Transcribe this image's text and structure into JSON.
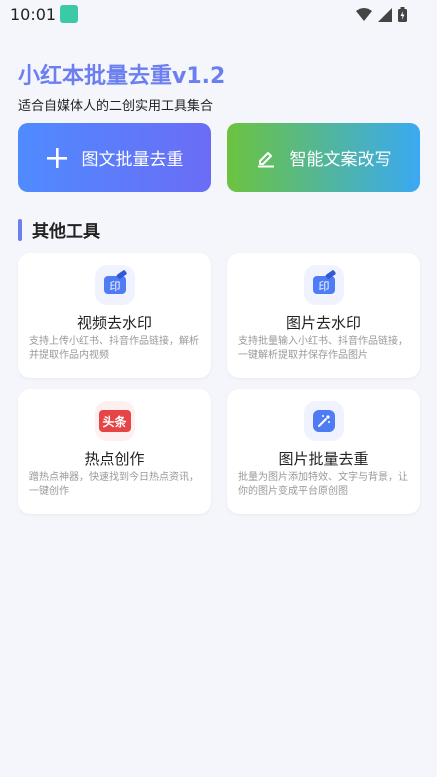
{
  "status": {
    "time": "10:01"
  },
  "header": {
    "title": "小红本批量去重v1.2",
    "subtitle": "适合自媒体人的二创实用工具集合"
  },
  "actions": {
    "left_label": "图文批量去重",
    "right_label": "智能文案改写"
  },
  "section": {
    "title": "其他工具"
  },
  "tools": [
    {
      "name": "视频去水印",
      "desc": "支持上传小红书、抖音作品链接，解析并提取作品内视频",
      "icon": "watermark-video-icon"
    },
    {
      "name": "图片去水印",
      "desc": "支持批量输入小红书、抖音作品链接，一键解析提取并保存作品图片",
      "icon": "watermark-image-icon"
    },
    {
      "name": "热点创作",
      "desc": "蹭热点神器，快速找到今日热点资讯，一键创作",
      "icon": "hot-topic-icon",
      "badge": "头条"
    },
    {
      "name": "图片批量去重",
      "desc": "批量为图片添加特效、文字与背景，让你的图片变成平台原创图",
      "icon": "magic-image-icon"
    }
  ],
  "colors": {
    "accent": "#6b7ff0",
    "btn_left_start": "#4f8bff",
    "btn_left_end": "#6b6cf5",
    "btn_right_start": "#6cc33f",
    "btn_right_end": "#3aa9f2",
    "hot_red": "#e64545"
  }
}
